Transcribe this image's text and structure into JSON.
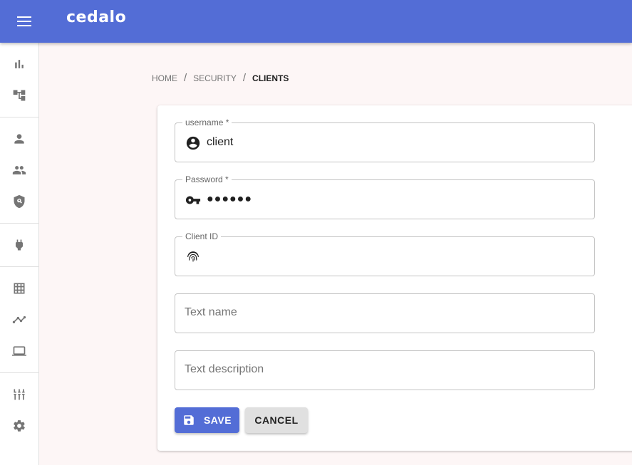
{
  "app": {
    "title": "cedalo",
    "brand_color": "#536dd6"
  },
  "sidebar": {
    "groups": [
      [
        {
          "icon": "bar-chart-icon",
          "label": "Dashboard"
        },
        {
          "icon": "tree-structure-icon",
          "label": "Topology"
        }
      ],
      [
        {
          "icon": "person-icon",
          "label": "Clients"
        },
        {
          "icon": "group-icon",
          "label": "Groups"
        },
        {
          "icon": "policy-shield-icon",
          "label": "Roles"
        }
      ],
      [
        {
          "icon": "plug-icon",
          "label": "Connections"
        }
      ],
      [
        {
          "icon": "grid-icon",
          "label": "Streams"
        },
        {
          "icon": "timeline-icon",
          "label": "Charts"
        },
        {
          "icon": "laptop-icon",
          "label": "Devices"
        }
      ],
      [
        {
          "icon": "tune-icon",
          "label": "Config"
        },
        {
          "icon": "gear-icon",
          "label": "Settings"
        }
      ]
    ]
  },
  "breadcrumb": {
    "items": [
      "HOME",
      "SECURITY"
    ],
    "separator": "/",
    "current": "CLIENTS"
  },
  "form": {
    "username": {
      "label": "username *",
      "value": "client",
      "icon": "account-circle-icon"
    },
    "password": {
      "label": "Password *",
      "value": "●●●●●●",
      "icon": "key-icon"
    },
    "client_id": {
      "label": "Client ID",
      "value": "",
      "icon": "fingerprint-icon"
    },
    "text_name": {
      "placeholder": "Text name",
      "value": ""
    },
    "text_description": {
      "placeholder": "Text description",
      "value": ""
    },
    "save_label": "SAVE",
    "cancel_label": "CANCEL"
  }
}
